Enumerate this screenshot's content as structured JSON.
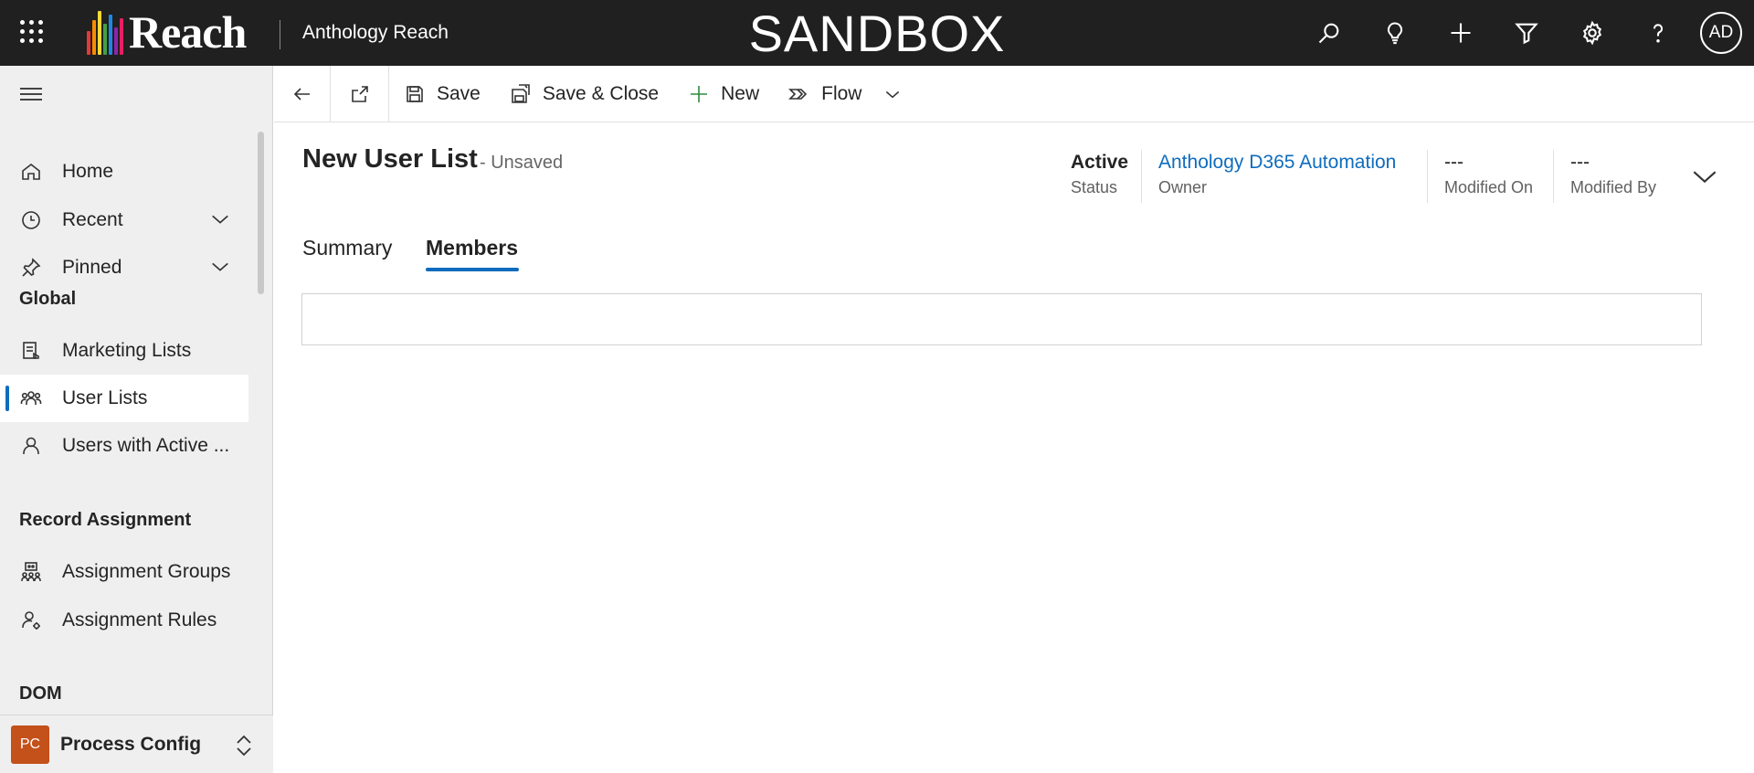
{
  "topbar": {
    "logo_text": "Reach",
    "app_name": "Anthology Reach",
    "environment_banner": "SANDBOX",
    "icons": [
      "search-icon",
      "lightbulb-icon",
      "plus-icon",
      "filter-icon",
      "gear-icon",
      "help-icon"
    ],
    "user_initials": "AD",
    "logo_bar_colors": [
      "#e53935",
      "#fb8c00",
      "#fdd835",
      "#43a047",
      "#1e88e5",
      "#8e24aa",
      "#e91e63",
      "#00acc1"
    ]
  },
  "sidebar": {
    "items_top": [
      {
        "label": "Home",
        "icon": "home-icon"
      },
      {
        "label": "Recent",
        "icon": "clock-icon"
      },
      {
        "label": "Pinned",
        "icon": "pin-icon"
      }
    ],
    "groups": [
      {
        "title": "Global",
        "items": [
          {
            "label": "Marketing Lists",
            "icon": "marketing-list-icon"
          },
          {
            "label": "User Lists",
            "icon": "people-icon",
            "active": true
          },
          {
            "label": "Users with Active ...",
            "icon": "person-icon"
          }
        ]
      },
      {
        "title": "Record Assignment",
        "items": [
          {
            "label": "Assignment Groups",
            "icon": "assignment-group-icon"
          },
          {
            "label": "Assignment Rules",
            "icon": "person-settings-icon"
          }
        ]
      },
      {
        "title": "DOM",
        "items": []
      }
    ],
    "area": {
      "badge": "PC",
      "label": "Process Config"
    },
    "accent_color": "#0f6cbd"
  },
  "commandbar": {
    "save": "Save",
    "save_close": "Save & Close",
    "new": "New",
    "flow": "Flow"
  },
  "record": {
    "title": "New User List",
    "subtitle": "- Unsaved",
    "header_fields": [
      {
        "value": "Active",
        "label": "Status"
      },
      {
        "value": "Anthology D365 Automation",
        "label": "Owner",
        "link": true
      },
      {
        "value": "---",
        "label": "Modified On"
      },
      {
        "value": "---",
        "label": "Modified By"
      }
    ]
  },
  "tabs": [
    {
      "label": "Summary",
      "active": false
    },
    {
      "label": "Members",
      "active": true
    }
  ]
}
